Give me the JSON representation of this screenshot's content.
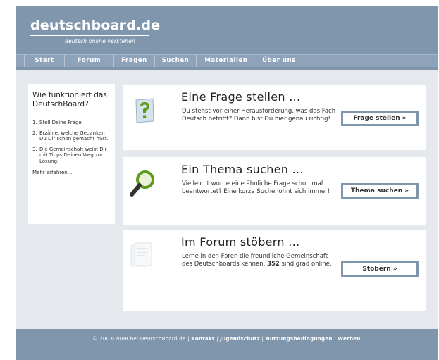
{
  "header": {
    "logo": "deutschboard.de",
    "tagline": "deutsch online verstehen"
  },
  "nav": {
    "items": [
      {
        "label": "Start"
      },
      {
        "label": "Forum"
      },
      {
        "label": "Fragen"
      },
      {
        "label": "Suchen"
      },
      {
        "label": "Materialien"
      },
      {
        "label": "Über uns"
      },
      {
        "label": ""
      }
    ]
  },
  "sidebar": {
    "title": "Wie funktioniert das DeutschBoard?",
    "steps": [
      {
        "num": "1.",
        "text": "Stell Deine Frage."
      },
      {
        "num": "2.",
        "text": "Erzähle, welche Gedanken Du Dir schon gemacht hast."
      },
      {
        "num": "3.",
        "text": "Die Gemeinschaft weist Dir mit Tipps Deinen Weg zur Lösung."
      }
    ],
    "more_link": "Mehr erfahren ..."
  },
  "cards": [
    {
      "title": "Eine Frage stellen ...",
      "text": "Du stehst vor einer Herausforderung, was das Fach Deutsch betrifft? Dann bist Du hier genau richtig!",
      "button": "Frage stellen »",
      "icon": "question-icon"
    },
    {
      "title": "Ein Thema suchen ...",
      "text": "Vielleicht wurde eine ähnliche Frage schon mal beantwortet? Eine kurze Suche lohnt sich immer!",
      "button": "Thema suchen »",
      "icon": "magnifier-icon"
    },
    {
      "title": "Im Forum stöbern ...",
      "text_before": "Lerne in den Foren die freundliche Gemeinschaft des Deutschboards kennen.",
      "online_count": "352",
      "text_after": "sind grad online.",
      "button": "Stöbern »",
      "icon": "documents-icon"
    }
  ],
  "footer": {
    "copyright": "© 2003-2008 bei DeutschBoard.de",
    "separator": "|",
    "links": [
      "Kontakt",
      "Jugendschutz",
      "Nutzungsbedingungen",
      "Werben"
    ]
  },
  "colors": {
    "header": "#7f96ad",
    "content_bg": "#e5e9ee",
    "icon_green": "#5e9a1c"
  }
}
